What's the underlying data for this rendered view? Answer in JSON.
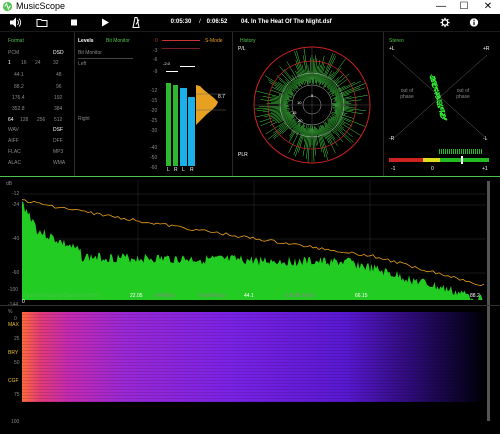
{
  "app": {
    "title": "MusicScope"
  },
  "toolbar": {
    "time_elapsed": "0:05:30",
    "time_sep": "/",
    "time_total": "0:06:52",
    "track": "04. In The Heat Of The Night.dsf"
  },
  "window_controls": {
    "minimize": "—",
    "maximize": "☐",
    "close": "✕"
  },
  "format": {
    "title": "Format",
    "pcm": "PCM",
    "dsd": "DSD",
    "bits": [
      "1",
      "16",
      "24",
      "32"
    ],
    "dsd_rate": "D32",
    "rates": [
      [
        "44.1",
        "48"
      ],
      [
        "88.2",
        "96"
      ],
      [
        "176.4",
        "192"
      ],
      [
        "352.8",
        "384"
      ]
    ],
    "dsd_rates": [
      "64",
      "128",
      "256",
      "512"
    ],
    "types": [
      [
        "WAV",
        "DSF"
      ],
      [
        "AIFF",
        "DFF"
      ],
      [
        "FLAC",
        "MP3"
      ],
      [
        "ALAC",
        "WMA"
      ]
    ]
  },
  "levels": {
    "title": "Levels",
    "bit_monitor": "Bit Monitor",
    "bit_monitor_sub": "Bit Monitor",
    "left": "Left",
    "right": "Right",
    "s_mode": "S-Mode",
    "scale": [
      "0",
      "-3",
      "-6",
      "-9",
      "-12",
      "-15",
      "-20",
      "-25",
      "-30",
      "-40",
      "-50",
      "-60"
    ],
    "peak_left": "-2.0",
    "peak_right": "-3.0",
    "bar_labels": [
      "L",
      "R",
      "L",
      "R"
    ],
    "histogram_value": "8.7",
    "left_level": 0.62,
    "right_level": 0.55
  },
  "history": {
    "title": "History",
    "pl": "P/L",
    "plr": "PLR",
    "rings": [
      "5",
      "10",
      "15",
      "20"
    ]
  },
  "stereo": {
    "title": "Stereo",
    "plus_l": "+L",
    "plus_r": "+R",
    "minus_r": "-R",
    "minus_l": "-L",
    "out_of_phase": "out of phase",
    "correlation_labels": [
      "-1",
      "0",
      "+1"
    ]
  },
  "spectrum": {
    "db_label": "dB",
    "y_labels": [
      "-12",
      "-24",
      "-40",
      "-60",
      "-100",
      "-144"
    ],
    "x_labels": [
      "0",
      "22.05",
      "44.1",
      "66.15",
      "88.2"
    ],
    "mode_labels": [
      "Linear Frequency Spectrum (kHz)",
      "Left/Right",
      "Peak/Phase",
      "-200dB Mode"
    ]
  },
  "spectrogram": {
    "pct": "%",
    "y_labels": [
      "0",
      "25",
      "50",
      "75",
      "100"
    ],
    "markers": [
      "MAX",
      "BRY",
      "CGF"
    ]
  },
  "colors": {
    "accent_green": "#4ec24e",
    "spectrum_fill": "#22cc22",
    "meter_green": "#2eb82e",
    "meter_cyan": "#1ab0e8",
    "histogram": "#e8a020",
    "ring_red": "#cc2222"
  }
}
